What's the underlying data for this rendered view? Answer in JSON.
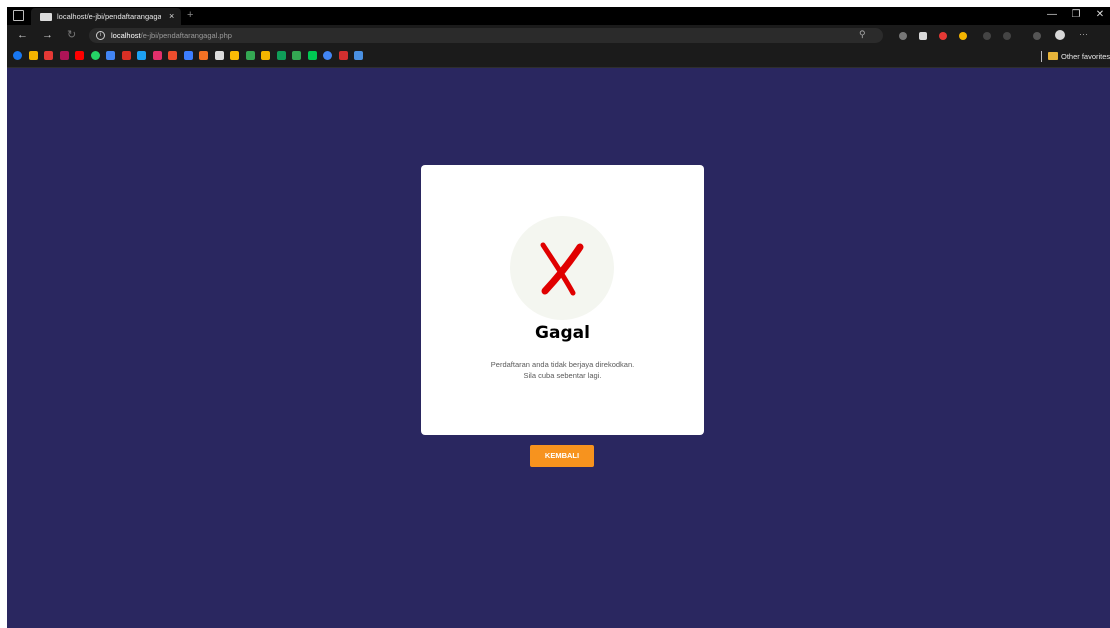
{
  "browser": {
    "tab_title": "localhost/e-jbi/pendaftarangagal.php",
    "new_tab_symbol": "+",
    "tab_close_symbol": "×",
    "url_host": "localhost",
    "url_path": "/e-jbi/pendaftarangagal.php",
    "other_favorites": "Other favorites",
    "bookmark_icons": [
      "facebook",
      "chrome",
      "flag",
      "shield",
      "youtube",
      "whatsapp",
      "docs",
      "gmail",
      "twitter",
      "instagram",
      "shopee",
      "tasks",
      "lazada",
      "mail",
      "chart",
      "drive",
      "card",
      "sheets",
      "circle",
      "shield-green",
      "google",
      "link",
      "mail-blue"
    ],
    "colors": {
      "bookmarks": [
        "#1877f2",
        "#f4b400",
        "#e53935",
        "#ad1457",
        "#ff0000",
        "#25d366",
        "#4285f4",
        "#d93025",
        "#1da1f2",
        "#e1306c",
        "#ee4d2d",
        "#3d7eff",
        "#f57224",
        "#dcdcdc",
        "#fbbc05",
        "#34a853",
        "#f4b400",
        "#0f9d58",
        "#34a853",
        "#00c853",
        "#4285f4",
        "#d32f2f",
        "#4a90e2"
      ]
    }
  },
  "page": {
    "title": "Gagal",
    "message_line1": "Perdaftaran anda tidak berjaya direkodkan.",
    "message_line2": "Sila cuba sebentar lagi.",
    "button_label": "KEMBALI",
    "status_icon": "x-mark-icon",
    "colors": {
      "background": "#2a2760",
      "button": "#f7931e",
      "x_mark": "#e00000"
    }
  }
}
